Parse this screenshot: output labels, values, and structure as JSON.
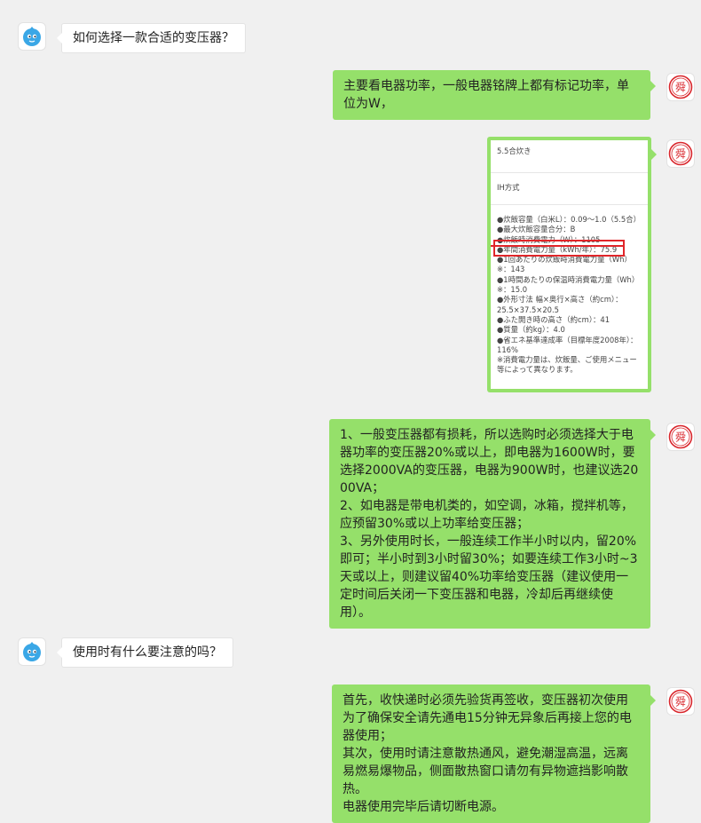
{
  "conversation": {
    "q1": "如何选择一款合适的变压器？",
    "a1": "主要看电器功率，一般电器铭牌上都有标记功率，单位为W，",
    "spec_image": {
      "title1": "5.5合炊き",
      "title2": "IH方式",
      "lines": [
        "●炊飯容量（白米L）：0.09〜1.0（5.5合）",
        "●最大炊飯容量合分：B",
        "●炊飯時消費電力（W）：1105",
        "●年間消費電力量（kWh/年）：75.9",
        "●1回あたりの炊飯時消費電力量（Wh）※：143",
        "●1時間あたりの保温時消費電力量（Wh）※：15.0",
        "●外形寸法 幅×奥行×高さ（約cm）：25.5×37.5×20.5",
        "●ふた開き時の高さ（約cm）：41",
        "●質量（約kg）：4.0",
        "●省エネ基準達成率（目標年度2008年）：116%",
        "※消費電力量は、炊飯量、ご使用メニュー等によって異なります。"
      ]
    },
    "a2": "1、一般变压器都有损耗，所以选购时必须选择大于电器功率的变压器20%或以上，即电器为1600W时，要选择2000VA的变压器，电器为900W时，也建议选2000VA；\n2、如电器是带电机类的，如空调，冰箱，搅拌机等，应预留30%或以上功率给变压器；\n3、另外使用时长，一般连续工作半小时以内，留20%即可；半小时到3小时留30%；如要连续工作3小时~3天或以上，则建议留40%功率给变压器（建议使用一定时间后关闭一下变压器和电器，冷却后再继续使用）。",
    "q2": "使用时有什么要注意的吗？",
    "a3": "首先，收快递时必须先验货再签收，变压器初次使用为了确保安全请先通电15分钟无异象后再接上您的电器使用；\n其次，使用时请注意散热通风，避免潮湿高温，远离易燃易爆物品，侧面散热窗口请勿有异物遮挡影响散热。\n电器使用完毕后请切断电源。"
  },
  "brand": {
    "logo_char": "舜",
    "accent": "#d9262c",
    "bubble_green": "#95e06a"
  }
}
